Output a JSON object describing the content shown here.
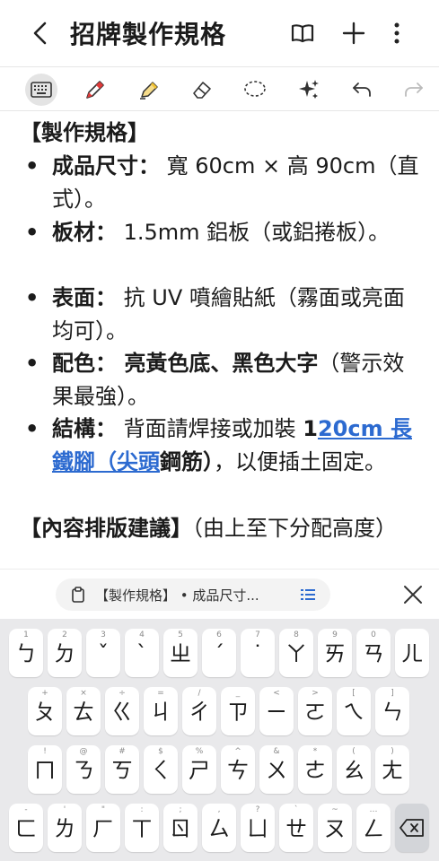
{
  "header": {
    "title": "招牌製作規格",
    "back_icon": "chevron-left-icon",
    "icons": [
      "book-icon",
      "plus-icon",
      "more-vert-icon"
    ]
  },
  "toolbar": {
    "tools": [
      "keyboard-icon",
      "pen-icon",
      "highlighter-icon",
      "eraser-icon",
      "lasso-icon",
      "ai-sparkle-icon",
      "undo-icon",
      "redo-icon"
    ],
    "active": "keyboard-icon",
    "pen_color": "#e03a3a",
    "highlighter_color": "#f1c232"
  },
  "note": {
    "section1": "【製作規格】",
    "items": [
      {
        "label": "成品尺寸：",
        "text": " 寬 60cm × 高 90cm（直式）。"
      },
      {
        "label": "板材：",
        "text": " 1.5mm 鋁板（或鋁捲板）。"
      },
      {
        "label": "表面：",
        "text": " 抗 UV 噴繪貼紙（霧面或亮面均可）。"
      },
      {
        "label": "配色：",
        "text_bold": " 亮黃色底、黑色大字",
        "text": "（警示效果最強）。"
      },
      {
        "label": "結構：",
        "text_pre": " 背面請焊接或加裝 ",
        "bold1": "1",
        "link": "20cm 長鐵腳（尖頭",
        "bold2": "鋼筋）",
        "text_post": "，以便插土固定。"
      }
    ],
    "section2_bold": "【內容排版建議】",
    "section2_rest": "（由上至下分配高度）",
    "link_color": "#2c6ad0"
  },
  "suggestion": {
    "chip_text": "【製作規格】 • 成品尺寸...",
    "chip_icon": "clipboard-icon",
    "list_icon": "list-icon",
    "close_icon": "close-icon"
  },
  "keyboard": {
    "row1": [
      {
        "k": "ㄅ",
        "s": "1"
      },
      {
        "k": "ㄉ",
        "s": "2"
      },
      {
        "k": "ˇ",
        "s": "3"
      },
      {
        "k": "ˋ",
        "s": "4"
      },
      {
        "k": "ㄓ",
        "s": "5"
      },
      {
        "k": "ˊ",
        "s": "6"
      },
      {
        "k": "˙",
        "s": "7"
      },
      {
        "k": "ㄚ",
        "s": "8"
      },
      {
        "k": "ㄞ",
        "s": "9"
      },
      {
        "k": "ㄢ",
        "s": "0"
      },
      {
        "k": "ㄦ",
        "s": ""
      }
    ],
    "row2": [
      {
        "k": "ㄆ",
        "s": "+"
      },
      {
        "k": "ㄊ",
        "s": "×"
      },
      {
        "k": "ㄍ",
        "s": "÷"
      },
      {
        "k": "ㄐ",
        "s": "="
      },
      {
        "k": "ㄔ",
        "s": "/"
      },
      {
        "k": "ㄗ",
        "s": "_"
      },
      {
        "k": "ㄧ",
        "s": "<"
      },
      {
        "k": "ㄛ",
        "s": ">"
      },
      {
        "k": "ㄟ",
        "s": "["
      },
      {
        "k": "ㄣ",
        "s": "]"
      }
    ],
    "row3": [
      {
        "k": "ㄇ",
        "s": "!"
      },
      {
        "k": "ㄋ",
        "s": "@"
      },
      {
        "k": "ㄎ",
        "s": "#"
      },
      {
        "k": "ㄑ",
        "s": "$"
      },
      {
        "k": "ㄕ",
        "s": "%"
      },
      {
        "k": "ㄘ",
        "s": "^"
      },
      {
        "k": "ㄨ",
        "s": "&"
      },
      {
        "k": "ㄜ",
        "s": "*"
      },
      {
        "k": "ㄠ",
        "s": "("
      },
      {
        "k": "ㄤ",
        "s": ")"
      }
    ],
    "row4": [
      {
        "k": "ㄈ",
        "s": "-"
      },
      {
        "k": "ㄌ",
        "s": "'"
      },
      {
        "k": "ㄏ",
        "s": "\""
      },
      {
        "k": "ㄒ",
        "s": ":"
      },
      {
        "k": "ㄖ",
        "s": ";"
      },
      {
        "k": "ㄙ",
        "s": ","
      },
      {
        "k": "ㄩ",
        "s": "?"
      },
      {
        "k": "ㄝ",
        "s": "`"
      },
      {
        "k": "ㄡ",
        "s": "~"
      },
      {
        "k": "ㄥ",
        "s": "…"
      }
    ],
    "backspace_icon": "backspace-icon"
  }
}
